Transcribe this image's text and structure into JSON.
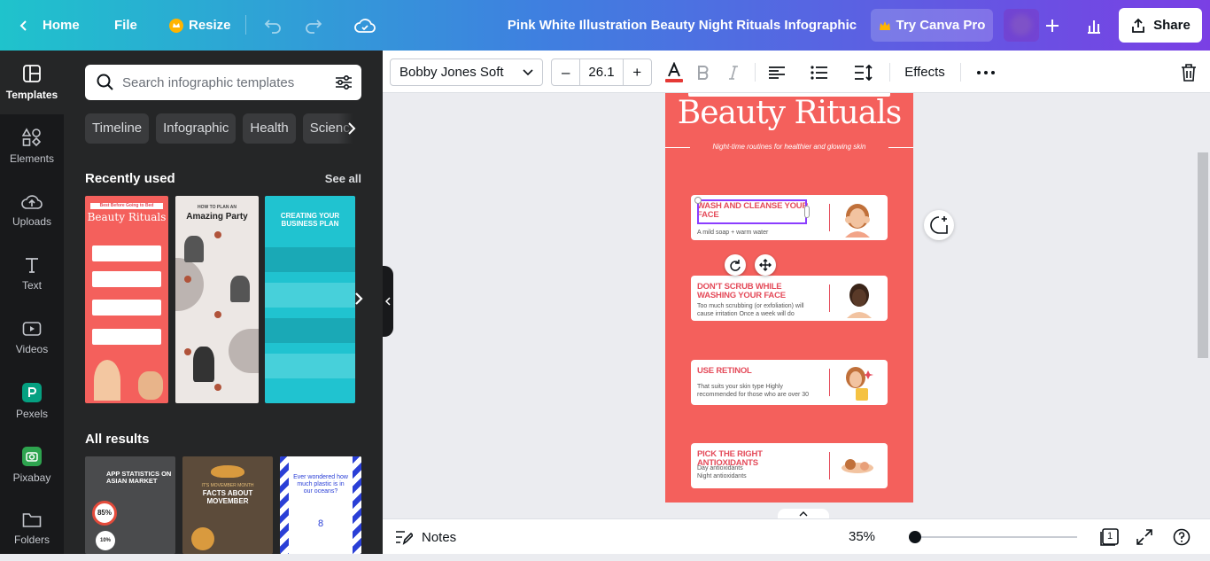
{
  "header": {
    "home_label": "Home",
    "file_label": "File",
    "resize_label": "Resize",
    "doc_title": "Pink White Illustration Beauty Night Rituals Infographic",
    "pro_label": "Try Canva Pro",
    "share_label": "Share"
  },
  "rail": {
    "items": [
      {
        "label": "Templates",
        "icon": "templates-icon"
      },
      {
        "label": "Elements",
        "icon": "elements-icon"
      },
      {
        "label": "Uploads",
        "icon": "upload-icon"
      },
      {
        "label": "Text",
        "icon": "text-icon"
      },
      {
        "label": "Videos",
        "icon": "video-icon"
      },
      {
        "label": "Pexels",
        "icon": "pexels-icon"
      },
      {
        "label": "Pixabay",
        "icon": "pixabay-icon"
      },
      {
        "label": "Folders",
        "icon": "folder-icon"
      }
    ]
  },
  "panel": {
    "search_placeholder": "Search infographic templates",
    "chips": [
      "Timeline",
      "Infographic",
      "Health",
      "Science"
    ],
    "recently_used": "Recently used",
    "see_all": "See all",
    "all_results": "All results",
    "recent": [
      {
        "title": "Beauty Rituals",
        "kicker": "Best Before Going to Bed"
      },
      {
        "title": "Amazing Party",
        "kicker": "HOW TO PLAN AN"
      },
      {
        "title": "CREATING YOUR BUSINESS PLAN",
        "kicker": ""
      }
    ],
    "results": [
      {
        "title": "APP STATISTICS ON ASIAN MARKET",
        "stat1": "85%",
        "stat2": "10%"
      },
      {
        "title": "FACTS ABOUT MOVEMBER",
        "kicker": "IT'S MOVEMBER MONTH"
      },
      {
        "title": "Ever wondered how much plastic is in our oceans?",
        "stat": "8"
      }
    ]
  },
  "toolbar": {
    "font": "Bobby Jones Soft",
    "size": "26.1",
    "effects": "Effects",
    "text_color": "#e53935"
  },
  "page": {
    "title": "Beauty Rituals",
    "subtitle": "Night-time routines for healthier and glowing skin",
    "cards": [
      {
        "head": "WASH AND CLEANSE YOUR FACE",
        "body": [
          "A mild soap + warm water"
        ]
      },
      {
        "head": "DON'T SCRUB WHILE WASHING YOUR FACE",
        "body": [
          "Too much scrubbing (or exfoliation) will",
          "cause irritation Once a week will do"
        ]
      },
      {
        "head": "USE RETINOL",
        "body": [
          "That suits your skin type Highly",
          "recommended for those who are over 30"
        ]
      },
      {
        "head": "PICK THE RIGHT ANTIOXIDANTS",
        "body": [
          "Day antioxidants",
          "Night antioxidants"
        ]
      }
    ]
  },
  "footer": {
    "notes": "Notes",
    "zoom": "35%",
    "page_count": "1"
  },
  "colors": {
    "page_bg": "#f4605c",
    "accent": "#8b3dff",
    "card_head": "#e44b5a"
  }
}
